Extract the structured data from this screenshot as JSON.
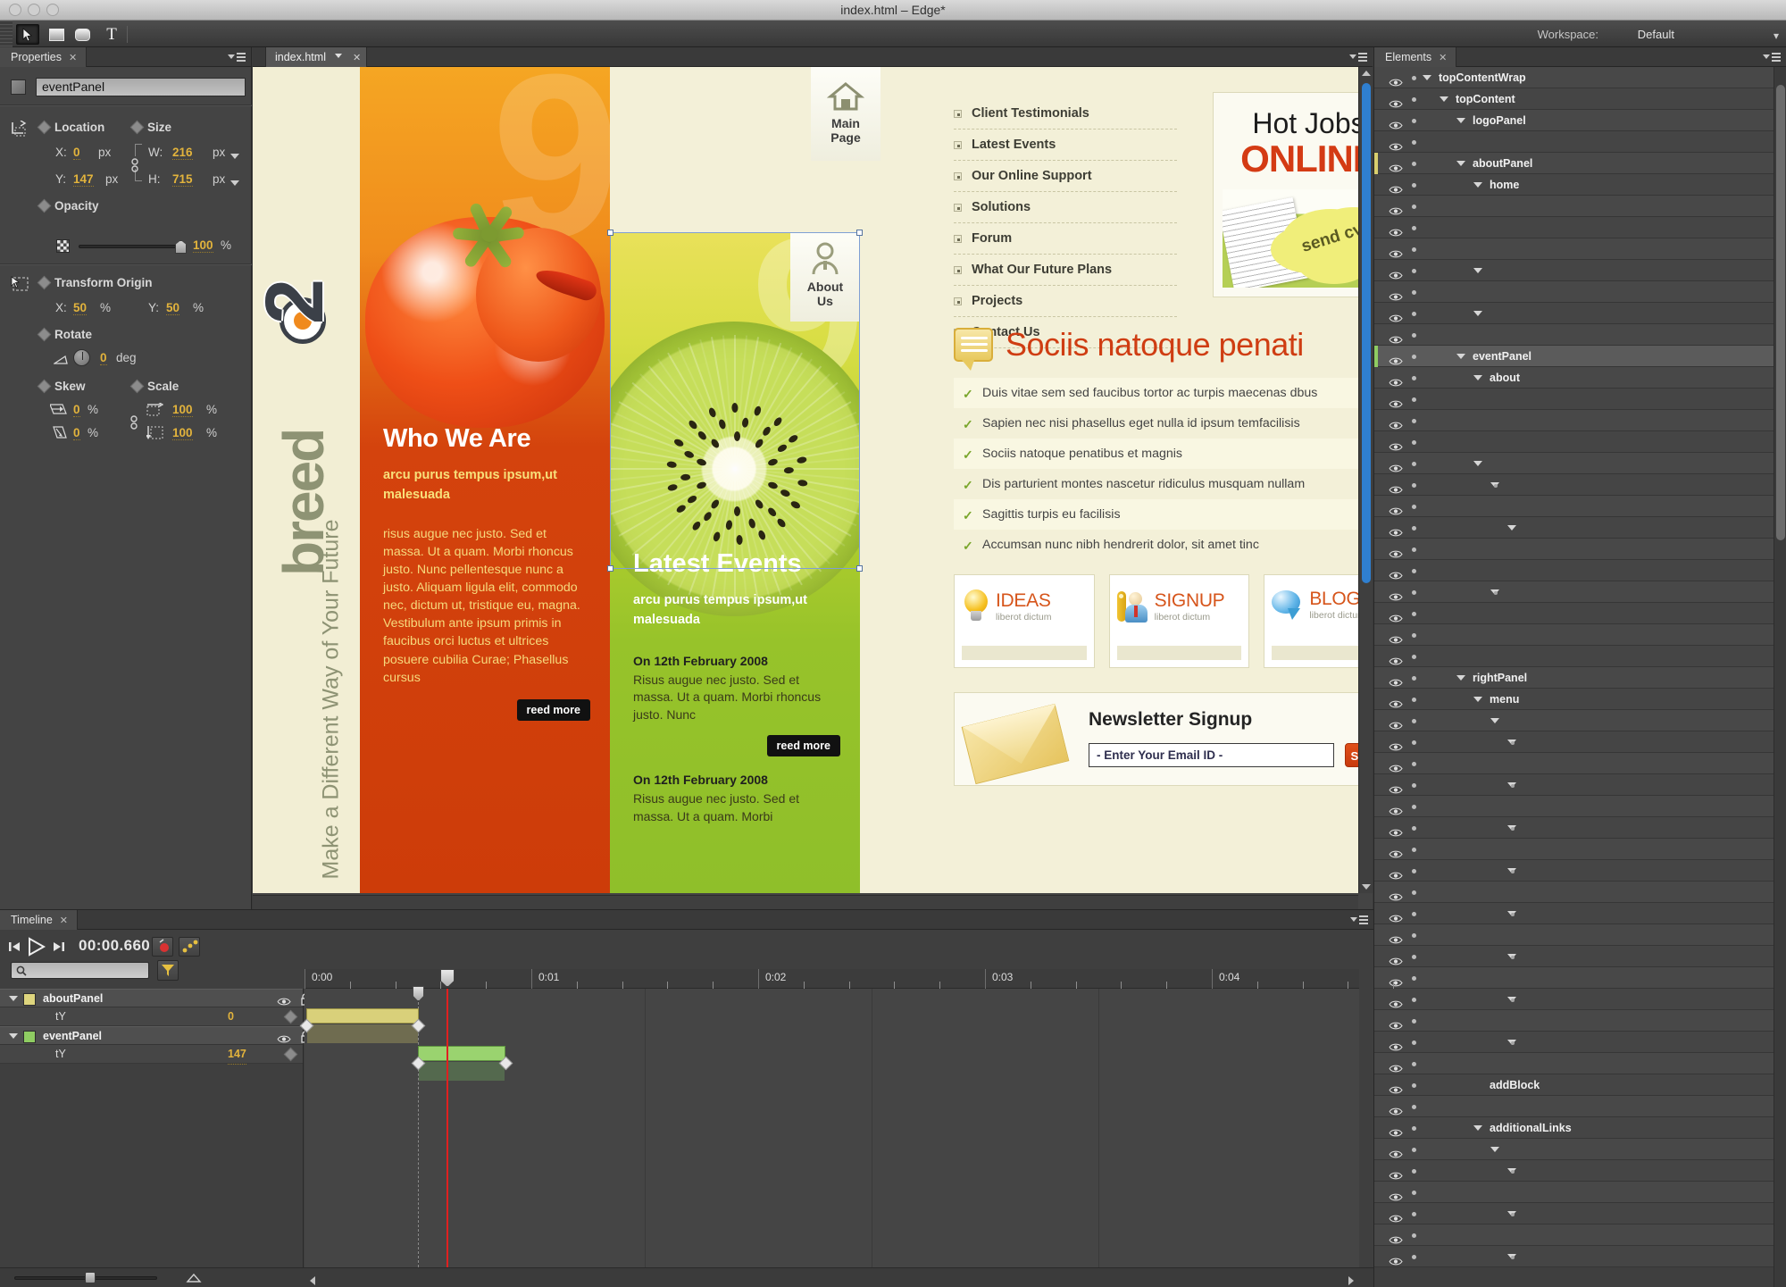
{
  "window": {
    "title": "index.html – Edge*"
  },
  "toolbar": {
    "tools": [
      {
        "name": "selection-tool",
        "glyph": "arrow"
      },
      {
        "name": "rectangle-tool",
        "glyph": "rect"
      },
      {
        "name": "rounded-rectangle-tool",
        "glyph": "rounded"
      },
      {
        "name": "text-tool",
        "glyph": "T"
      }
    ],
    "workspace_label": "Workspace:",
    "workspace_value": "Default"
  },
  "properties": {
    "tab_label": "Properties",
    "element_id": "eventPanel",
    "groups": {
      "location": {
        "label": "Location",
        "x_label": "X:",
        "x_value": "0",
        "x_unit": "px",
        "y_label": "Y:",
        "y_value": "147",
        "y_unit": "px"
      },
      "size": {
        "label": "Size",
        "w_label": "W:",
        "w_value": "216",
        "w_unit": "px",
        "h_label": "H:",
        "h_value": "715",
        "h_unit": "px"
      },
      "opacity": {
        "label": "Opacity",
        "value": "100",
        "unit": "%"
      },
      "transform_origin": {
        "label": "Transform Origin",
        "x_label": "X:",
        "x_value": "50",
        "x_unit": "%",
        "y_label": "Y:",
        "y_value": "50",
        "y_unit": "%"
      },
      "rotate": {
        "label": "Rotate",
        "value": "0",
        "unit": "deg"
      },
      "skew": {
        "label": "Skew",
        "x_value": "0",
        "x_unit": "%",
        "y_value": "0",
        "y_unit": "%"
      },
      "scale": {
        "label": "Scale",
        "w_value": "100",
        "w_unit": "%",
        "h_value": "100",
        "h_unit": "%"
      }
    }
  },
  "document": {
    "tab_label": "index.html"
  },
  "stage": {
    "logo_panel": {
      "brand_word": "breed",
      "brand_digit": "2",
      "tagline": "Make a Different Way of Your Future"
    },
    "about_panel": {
      "ghost_digit": "9",
      "heading": "Who We Are",
      "subheading": "arcu purus tempus ipsum,ut malesuada",
      "body": "risus augue nec justo. Sed et massa. Ut a quam. Morbi rhoncus justo. Nunc pellentesque nunc a justo. Aliquam ligula elit, commodo nec, dictum ut, tristique eu, magna. Vestibulum ante ipsum primis in faucibus orci luctus et ultrices posuere cubilia Curae; Phasellus cursus",
      "read_more": "reed more"
    },
    "main_page_button": {
      "line1": "Main",
      "line2": "Page"
    },
    "event_panel": {
      "ghost_digit": "9",
      "about_us_button": {
        "line1": "About",
        "line2": "Us"
      },
      "heading": "Latest Events",
      "subheading": "arcu purus tempus ipsum,ut malesuada",
      "events": [
        {
          "date": "On 12th February 2008",
          "body": "Risus augue nec justo. Sed et massa. Ut a quam. Morbi rhoncus justo. Nunc"
        },
        {
          "date": "On 12th February 2008",
          "body": "Risus augue nec justo. Sed et massa. Ut a quam. Morbi"
        }
      ],
      "read_more": "reed more"
    },
    "right_panel": {
      "menu": [
        "Client Testimonials",
        "Latest Events",
        "Our Online Support",
        "Solutions",
        "Forum",
        "What Our Future Plans",
        "Projects",
        "Contact Us"
      ],
      "hot_jobs": {
        "line1": "Hot Jobs",
        "line2": "ONLINE",
        "badge": "send cv"
      },
      "sociis": {
        "heading": "Sociis natoque penati",
        "items": [
          "Duis vitae sem sed faucibus tortor ac turpis maecenas dbus",
          "Sapien nec nisi phasellus eget nulla id ipsum temfacilisis",
          "Sociis natoque penatibus et magnis",
          "Dis parturient montes nascetur ridiculus musquam nullam",
          "Sagittis turpis eu facilisis",
          "Accumsan nunc nibh hendrerit dolor, sit amet tinc"
        ]
      },
      "promos": [
        {
          "title": "IDEAS",
          "sub": "liberot dictum",
          "icon": "lightbulb-icon"
        },
        {
          "title": "SIGNUP",
          "sub": "liberot dictum",
          "icon": "key-user-icon"
        },
        {
          "title": "BLOG",
          "sub": "liberot dictum",
          "icon": "speech-bubble-icon"
        }
      ],
      "newsletter": {
        "heading": "Newsletter Signup",
        "input_value": "- Enter Your Email ID -",
        "submit_label": "Submit"
      }
    }
  },
  "elements_panel": {
    "tab_label": "Elements",
    "rows": [
      {
        "indent": 0,
        "name": "topContentWrap",
        "tag": "<div>",
        "twirl": true,
        "mark": "none"
      },
      {
        "indent": 1,
        "name": "topContent",
        "tag": "<div>",
        "twirl": true,
        "mark": "none"
      },
      {
        "indent": 2,
        "name": "logoPanel",
        "tag": "<div>",
        "twirl": true,
        "mark": "none"
      },
      {
        "indent": 4,
        "name": "",
        "tag": "<h1>",
        "twirl": false,
        "mark": "none"
      },
      {
        "indent": 2,
        "name": "aboutPanel",
        "tag": "<div>",
        "twirl": true,
        "mark": "yellow"
      },
      {
        "indent": 3,
        "name": "home",
        "tag": "<div>",
        "twirl": true,
        "mark": "none"
      },
      {
        "indent": 5,
        "name": "",
        "tag": "<a>",
        "twirl": false,
        "mark": "none"
      },
      {
        "indent": 4,
        "name": "",
        "tag": "<h2>",
        "twirl": false,
        "mark": "none"
      },
      {
        "indent": 4,
        "name": "",
        "tag": "<h3>",
        "twirl": false,
        "mark": "none"
      },
      {
        "indent": 3,
        "name": "",
        "tag": "<p>",
        "twirl": true,
        "mark": "none"
      },
      {
        "indent": 5,
        "name": "",
        "tag": "<a>",
        "twirl": false,
        "mark": "none"
      },
      {
        "indent": 3,
        "name": "",
        "tag": "<div>",
        "twirl": true,
        "mark": "none"
      },
      {
        "indent": 5,
        "name": "",
        "tag": "<a>",
        "twirl": false,
        "mark": "none"
      },
      {
        "indent": 2,
        "name": "eventPanel",
        "tag": "<div>",
        "twirl": true,
        "mark": "green",
        "selected": true
      },
      {
        "indent": 3,
        "name": "about",
        "tag": "<div>",
        "twirl": true,
        "mark": "none"
      },
      {
        "indent": 5,
        "name": "",
        "tag": "<a>",
        "twirl": false,
        "mark": "none"
      },
      {
        "indent": 4,
        "name": "",
        "tag": "<h2>",
        "twirl": false,
        "mark": "none"
      },
      {
        "indent": 4,
        "name": "",
        "tag": "<h3>",
        "twirl": false,
        "mark": "none"
      },
      {
        "indent": 3,
        "name": "",
        "tag": "<ul>",
        "twirl": true,
        "mark": "none"
      },
      {
        "indent": 4,
        "name": "",
        "tag": "<li>",
        "twirl": true,
        "mark": "none"
      },
      {
        "indent": 6,
        "name": "",
        "tag": "<h2>",
        "twirl": false,
        "mark": "none"
      },
      {
        "indent": 5,
        "name": "",
        "tag": "<p>",
        "twirl": true,
        "mark": "none"
      },
      {
        "indent": 7,
        "name": "",
        "tag": "<a>",
        "twirl": false,
        "mark": "none"
      },
      {
        "indent": 6,
        "name": "",
        "tag": "<a>",
        "twirl": false,
        "mark": "none"
      },
      {
        "indent": 4,
        "name": "",
        "tag": "<li>",
        "twirl": true,
        "mark": "none"
      },
      {
        "indent": 6,
        "name": "",
        "tag": "<h2>",
        "twirl": false,
        "mark": "none"
      },
      {
        "indent": 6,
        "name": "",
        "tag": "<p>",
        "twirl": false,
        "mark": "none"
      },
      {
        "indent": 6,
        "name": "",
        "tag": "<a>",
        "twirl": false,
        "mark": "none"
      },
      {
        "indent": 2,
        "name": "rightPanel",
        "tag": "<div>",
        "twirl": true,
        "mark": "none"
      },
      {
        "indent": 3,
        "name": "menu",
        "tag": "<div>",
        "twirl": true,
        "mark": "none"
      },
      {
        "indent": 4,
        "name": "",
        "tag": "<ul>",
        "twirl": true,
        "mark": "none"
      },
      {
        "indent": 5,
        "name": "",
        "tag": "<li>",
        "twirl": true,
        "mark": "none"
      },
      {
        "indent": 6,
        "name": "",
        "tag": "<a>",
        "twirl": false,
        "mark": "none"
      },
      {
        "indent": 5,
        "name": "",
        "tag": "<li>",
        "twirl": true,
        "mark": "none"
      },
      {
        "indent": 6,
        "name": "",
        "tag": "<a>",
        "twirl": false,
        "mark": "none"
      },
      {
        "indent": 5,
        "name": "",
        "tag": "<li>",
        "twirl": true,
        "mark": "none"
      },
      {
        "indent": 6,
        "name": "",
        "tag": "<a>",
        "twirl": false,
        "mark": "none"
      },
      {
        "indent": 5,
        "name": "",
        "tag": "<li>",
        "twirl": true,
        "mark": "none"
      },
      {
        "indent": 6,
        "name": "",
        "tag": "<a>",
        "twirl": false,
        "mark": "none"
      },
      {
        "indent": 5,
        "name": "",
        "tag": "<li>",
        "twirl": true,
        "mark": "none"
      },
      {
        "indent": 6,
        "name": "",
        "tag": "<a>",
        "twirl": false,
        "mark": "none"
      },
      {
        "indent": 5,
        "name": "",
        "tag": "<li>",
        "twirl": true,
        "mark": "none"
      },
      {
        "indent": 6,
        "name": "",
        "tag": "<a>",
        "twirl": false,
        "mark": "none"
      },
      {
        "indent": 5,
        "name": "",
        "tag": "<li>",
        "twirl": true,
        "mark": "none"
      },
      {
        "indent": 6,
        "name": "",
        "tag": "<a>",
        "twirl": false,
        "mark": "none"
      },
      {
        "indent": 5,
        "name": "",
        "tag": "<li>",
        "twirl": true,
        "mark": "none"
      },
      {
        "indent": 6,
        "name": "",
        "tag": "<a>",
        "twirl": false,
        "mark": "none"
      },
      {
        "indent": 3,
        "name": "addBlock",
        "tag": "<div>",
        "twirl": false,
        "mark": "none"
      },
      {
        "indent": 4,
        "name": "",
        "tag": "<h2>",
        "twirl": false,
        "mark": "none"
      },
      {
        "indent": 3,
        "name": "additionalLinks",
        "tag": "<div>",
        "twirl": true,
        "mark": "none"
      },
      {
        "indent": 4,
        "name": "",
        "tag": "<ul>",
        "twirl": true,
        "mark": "none"
      },
      {
        "indent": 5,
        "name": "",
        "tag": "<li>",
        "twirl": true,
        "mark": "none"
      },
      {
        "indent": 6,
        "name": "",
        "tag": "<a>",
        "twirl": false,
        "mark": "none"
      },
      {
        "indent": 5,
        "name": "",
        "tag": "<li>",
        "twirl": true,
        "mark": "none"
      },
      {
        "indent": 6,
        "name": "",
        "tag": "<a>",
        "twirl": false,
        "mark": "none"
      },
      {
        "indent": 5,
        "name": "",
        "tag": "<li>",
        "twirl": true,
        "mark": "none"
      }
    ]
  },
  "timeline": {
    "tab_label": "Timeline",
    "current_time": "00:00.660",
    "search_placeholder": "",
    "ruler_labels": [
      "0:00",
      "0:01",
      "0:02",
      "0:03",
      "0:04"
    ],
    "layers": [
      {
        "name": "aboutPanel",
        "tag": "<div>",
        "color": "#ded57e",
        "property": {
          "name": "tY",
          "value": "0"
        }
      },
      {
        "name": "eventPanel",
        "tag": "<div>",
        "color": "#8fcc62",
        "property": {
          "name": "tY",
          "value": "147"
        }
      }
    ]
  },
  "colors": {
    "accent_orange": "#d4430d",
    "accent_green": "#9ad36f",
    "accent_yellow": "#e2b33c",
    "selection_blue": "#7f9fd4",
    "playhead_red": "#e02020"
  }
}
